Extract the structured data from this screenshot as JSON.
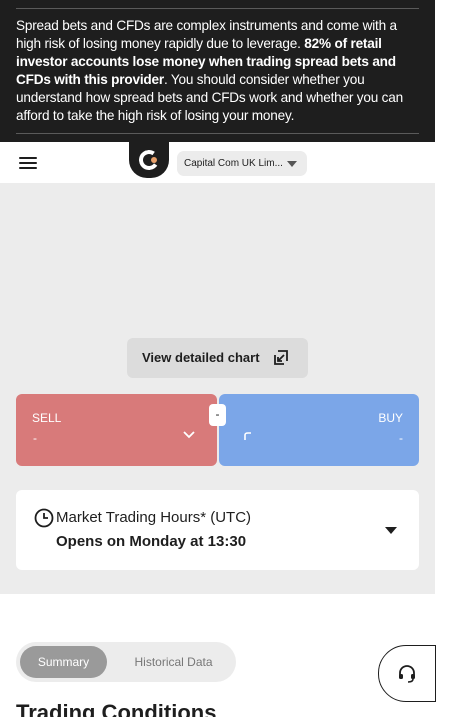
{
  "risk_warning": {
    "part1": "Spread bets and CFDs are complex instruments and come with a high risk of losing money rapidly due to leverage. ",
    "bold": "82% of retail investor accounts lose money when trading spread bets and CFDs with this provider",
    "part2": ". You should consider whether you understand how spread bets and CFDs work and whether you can afford to take the high risk of losing your money."
  },
  "header": {
    "entity_selector": "Capital Com UK Lim..."
  },
  "chart": {
    "view_detailed_label": "View detailed chart"
  },
  "trade": {
    "sell_label": "SELL",
    "sell_value": "-",
    "buy_label": "BUY",
    "buy_value": "-",
    "spread_value": "-"
  },
  "market_hours": {
    "title": "Market Trading Hours* (UTC)",
    "status": "Opens on Monday at 13:30"
  },
  "tabs": [
    {
      "label": "Summary",
      "active": true
    },
    {
      "label": "Historical Data",
      "active": false
    }
  ],
  "section": {
    "title": "Trading Conditions"
  },
  "colors": {
    "sell": "#d87a7a",
    "buy": "#7ba6e8",
    "banner": "#1e1e1e",
    "panel": "#ececec"
  }
}
